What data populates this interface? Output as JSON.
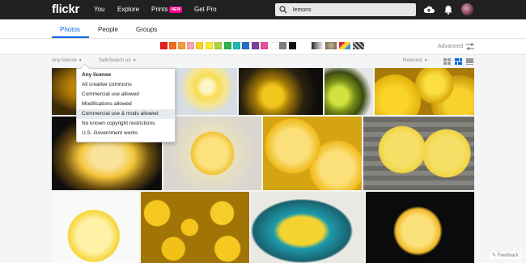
{
  "header": {
    "logo": "flickr",
    "nav": [
      {
        "label": "You"
      },
      {
        "label": "Explore"
      },
      {
        "label": "Prints",
        "badge": "NEW"
      },
      {
        "label": "Get Pro"
      }
    ],
    "search": {
      "value": "lemons",
      "icon": "search-icon"
    },
    "icons": [
      "upload-cloud-icon",
      "notifications-bell-icon",
      "avatar"
    ]
  },
  "tabs": [
    {
      "label": "Photos",
      "active": true
    },
    {
      "label": "People"
    },
    {
      "label": "Groups"
    }
  ],
  "color_filters": [
    "#e3201b",
    "#f26a24",
    "#f59a3b",
    "#f5a4b2",
    "#fbd127",
    "#f7ee34",
    "#a9d33b",
    "#2cb24a",
    "#1fb7b6",
    "#2170c6",
    "#7c3f9c",
    "#e94e9b",
    "#ffffff",
    "#7e7e7e",
    "#111111"
  ],
  "style_filters": [
    "black-and-white",
    "shallow-depth-of-field",
    "minimalist",
    "patterns"
  ],
  "advanced_label": "Advanced",
  "toolbar": {
    "license_label": "Any license",
    "safesearch_label": "SafeSearch on",
    "sort_label": "Relevant"
  },
  "license_menu": {
    "items": [
      {
        "label": "Any license",
        "selected": true
      },
      {
        "label": "All creative commons"
      },
      {
        "label": "Commercial use allowed"
      },
      {
        "label": "Modifications allowed"
      },
      {
        "label": "Commercial use & mods allowed",
        "hover": true
      },
      {
        "label": "No known copyright restrictions"
      },
      {
        "label": "U.S. Government works"
      }
    ]
  },
  "feedback_label": "Feedback"
}
